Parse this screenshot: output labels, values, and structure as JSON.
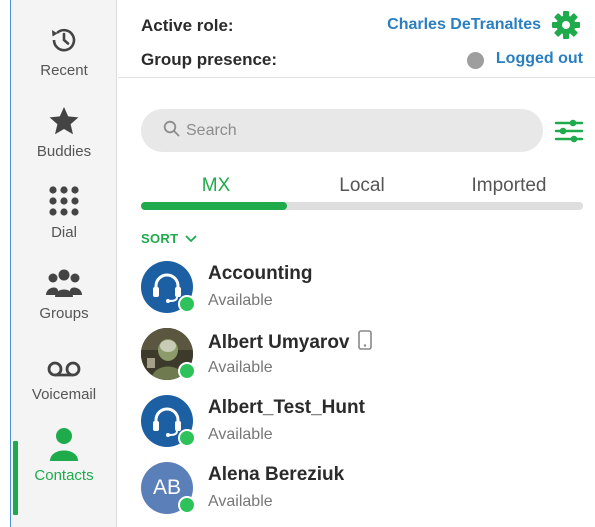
{
  "sidebar": {
    "items": [
      {
        "label": "Recent",
        "icon": "history-icon"
      },
      {
        "label": "Buddies",
        "icon": "star-icon"
      },
      {
        "label": "Dial",
        "icon": "dialpad-icon"
      },
      {
        "label": "Groups",
        "icon": "group-icon"
      },
      {
        "label": "Voicemail",
        "icon": "voicemail-icon"
      },
      {
        "label": "Contacts",
        "icon": "person-icon"
      }
    ],
    "active_index": 5
  },
  "header": {
    "active_role_label": "Active role:",
    "active_role_value": "Charles DeTranaltes",
    "group_presence_label": "Group presence:",
    "group_presence_value": "Logged out"
  },
  "search": {
    "placeholder": "Search"
  },
  "tabs": [
    {
      "label": "MX",
      "active": true
    },
    {
      "label": "Local",
      "active": false
    },
    {
      "label": "Imported",
      "active": false
    }
  ],
  "tab_progress": 0.33,
  "sort_label": "SORT",
  "contacts": [
    {
      "name": "Accounting",
      "status": "Available",
      "avatar": "headset-icon"
    },
    {
      "name": "Albert Umyarov",
      "status": "Available",
      "avatar": "photo",
      "badge": "mobile-phone-icon"
    },
    {
      "name": "Albert_Test_Hunt",
      "status": "Available",
      "avatar": "headset-icon"
    },
    {
      "name": "Alena Bereziuk",
      "status": "Available",
      "avatar": "initials",
      "initials": "AB"
    }
  ],
  "colors": {
    "accent_green": "#1faa4c",
    "link_blue": "#2a7fc1",
    "online_green": "#2ec25a",
    "offline_grey": "#9e9e9e",
    "avatar_blue": "#1d5fa3"
  }
}
